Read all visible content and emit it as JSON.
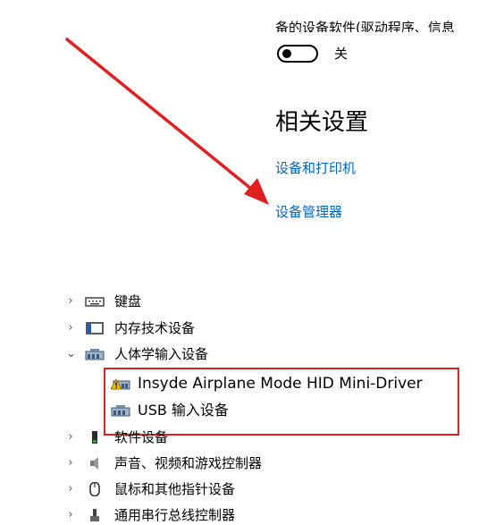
{
  "settings": {
    "cut_text": "备的设备软件(驱动程序、信息",
    "toggle_state_label": "关",
    "toggle_on": false,
    "related_title": "相关设置",
    "links": [
      "设备和打印机",
      "设备管理器"
    ]
  },
  "tree": {
    "items": [
      {
        "label": "键盘",
        "expanded": false,
        "icon": "keyboard-icon"
      },
      {
        "label": "内存技术设备",
        "expanded": false,
        "icon": "memory-device-icon"
      },
      {
        "label": "人体学输入设备",
        "expanded": true,
        "icon": "hid-icon",
        "children": [
          {
            "label": "Insyde Airplane Mode HID Mini-Driver",
            "icon": "hid-warning-icon"
          },
          {
            "label": "USB 输入设备",
            "icon": "hid-icon"
          }
        ]
      },
      {
        "label": "软件设备",
        "expanded": false,
        "icon": "software-device-icon"
      },
      {
        "label": "声音、视频和游戏控制器",
        "expanded": false,
        "icon": "speaker-icon"
      },
      {
        "label": "鼠标和其他指针设备",
        "expanded": false,
        "icon": "mouse-icon"
      },
      {
        "label": "通用串行总线控制器",
        "expanded": false,
        "icon": "usb-icon"
      }
    ]
  },
  "colors": {
    "link": "#0067c0",
    "annotation": "#e02020"
  }
}
